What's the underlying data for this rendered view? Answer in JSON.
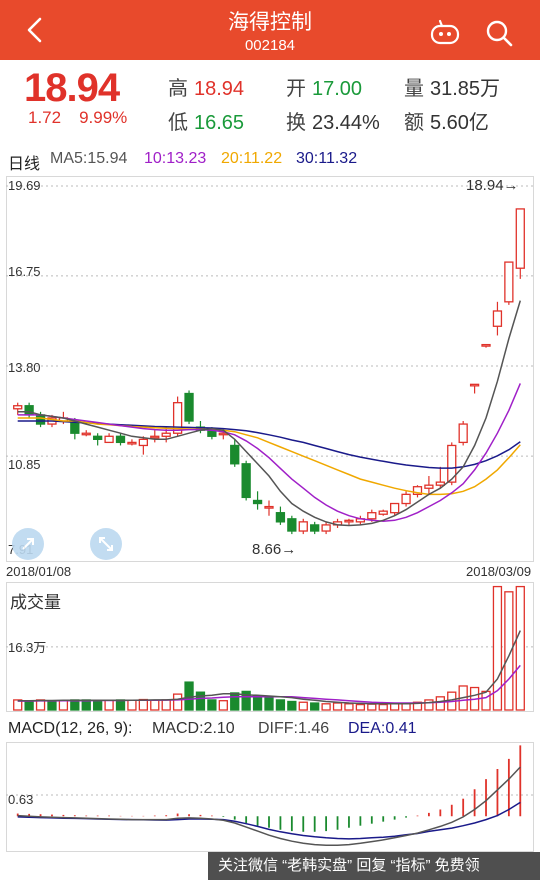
{
  "header": {
    "title": "海得控制",
    "code": "002184",
    "bg_color": "#e84a2c"
  },
  "quote": {
    "price": "18.94",
    "change": "1.72",
    "change_pct": "9.99%",
    "high_label": "高",
    "high": "18.94",
    "low_label": "低",
    "low": "16.65",
    "open_label": "开",
    "open": "17.00",
    "turnover_label": "换",
    "turnover": "23.44%",
    "volume_label": "量",
    "volume": "31.85万",
    "amount_label": "额",
    "amount": "5.60亿"
  },
  "ma_legend": {
    "label": "日线",
    "ma5": "MA5:15.94",
    "ma10": "10:13.23",
    "ma20": "20:11.22",
    "ma30": "30:11.32",
    "colors": {
      "ma5": "#555555",
      "ma10": "#a020c8",
      "ma20": "#f0a800",
      "ma30": "#1a1a8a"
    }
  },
  "macd_legend": {
    "label": "MACD(12, 26, 9):",
    "macd": "MACD:2.10",
    "diff": "DIFF:1.46",
    "dea": "DEA:0.41"
  },
  "footer": {
    "text": "关注微信 “老韩实盘” 回复 “指标” 免费领"
  },
  "chart_data": [
    {
      "type": "candlestick",
      "y_ticks": [
        "19.69",
        "16.75",
        "13.80",
        "10.85",
        "7.91"
      ],
      "ylim": [
        7.91,
        19.69
      ],
      "x_start_label": "2018/01/08",
      "x_end_label": "2018/03/09",
      "annotations": {
        "high": "18.94→",
        "low": "8.66→"
      },
      "candles": [
        [
          12.4,
          12.6,
          12.2,
          12.5
        ],
        [
          12.5,
          12.6,
          12.1,
          12.2
        ],
        [
          12.2,
          12.3,
          11.8,
          11.9
        ],
        [
          11.9,
          12.2,
          11.8,
          12.1
        ],
        [
          12.0,
          12.3,
          11.9,
          12.1
        ],
        [
          12.0,
          12.1,
          11.4,
          11.6
        ],
        [
          11.6,
          11.7,
          11.5,
          11.6
        ],
        [
          11.5,
          11.6,
          11.2,
          11.4
        ],
        [
          11.3,
          11.6,
          11.3,
          11.5
        ],
        [
          11.5,
          11.6,
          11.2,
          11.3
        ],
        [
          11.3,
          11.4,
          11.2,
          11.3
        ],
        [
          11.2,
          11.5,
          10.9,
          11.4
        ],
        [
          11.5,
          11.7,
          11.3,
          11.5
        ],
        [
          11.5,
          11.8,
          11.3,
          11.6
        ],
        [
          11.6,
          12.8,
          11.5,
          12.6
        ],
        [
          12.9,
          13.0,
          11.9,
          12.0
        ],
        [
          11.8,
          12.0,
          11.6,
          11.7
        ],
        [
          11.7,
          11.8,
          11.4,
          11.5
        ],
        [
          11.6,
          11.7,
          11.4,
          11.6
        ],
        [
          11.2,
          11.4,
          10.5,
          10.6
        ],
        [
          10.6,
          10.7,
          9.4,
          9.5
        ],
        [
          9.4,
          9.7,
          9.1,
          9.3
        ],
        [
          9.2,
          9.4,
          8.9,
          9.2
        ],
        [
          9.0,
          9.2,
          8.6,
          8.7
        ],
        [
          8.8,
          8.9,
          8.3,
          8.4
        ],
        [
          8.4,
          8.8,
          8.3,
          8.7
        ],
        [
          8.6,
          8.7,
          8.3,
          8.4
        ],
        [
          8.4,
          8.7,
          8.3,
          8.6
        ],
        [
          8.6,
          8.8,
          8.5,
          8.7
        ],
        [
          8.7,
          8.8,
          8.6,
          8.75
        ],
        [
          8.7,
          8.9,
          8.6,
          8.8
        ],
        [
          8.8,
          9.1,
          8.7,
          9.0
        ],
        [
          8.95,
          9.1,
          8.9,
          9.05
        ],
        [
          9.0,
          9.3,
          8.9,
          9.3
        ],
        [
          9.3,
          9.7,
          9.2,
          9.6
        ],
        [
          9.6,
          9.9,
          9.5,
          9.85
        ],
        [
          9.8,
          10.2,
          9.6,
          9.9
        ],
        [
          9.9,
          10.5,
          9.8,
          10.0
        ],
        [
          10.0,
          11.3,
          9.9,
          11.2
        ],
        [
          11.3,
          12.0,
          11.2,
          11.9
        ],
        [
          13.2,
          13.2,
          12.9,
          13.2
        ],
        [
          14.5,
          14.5,
          14.4,
          14.5
        ],
        [
          15.1,
          15.9,
          14.8,
          15.6
        ],
        [
          15.9,
          17.2,
          15.8,
          17.2
        ],
        [
          17.0,
          18.94,
          16.65,
          18.94
        ]
      ],
      "ma5": [
        12.3,
        12.3,
        12.2,
        12.15,
        12.1,
        12.0,
        11.9,
        11.8,
        11.7,
        11.6,
        11.5,
        11.45,
        11.4,
        11.4,
        11.5,
        11.6,
        11.7,
        11.75,
        11.7,
        11.4,
        11.0,
        10.6,
        10.2,
        9.7,
        9.3,
        9.05,
        8.85,
        8.7,
        8.6,
        8.58,
        8.6,
        8.65,
        8.75,
        8.9,
        9.1,
        9.35,
        9.6,
        9.8,
        10.1,
        10.5,
        11.2,
        12.1,
        13.3,
        14.7,
        15.94
      ],
      "ma10": [
        12.2,
        12.2,
        12.2,
        12.15,
        12.1,
        12.05,
        12.0,
        11.95,
        11.9,
        11.85,
        11.8,
        11.75,
        11.72,
        11.7,
        11.7,
        11.72,
        11.72,
        11.7,
        11.65,
        11.55,
        11.35,
        11.1,
        10.8,
        10.45,
        10.1,
        9.8,
        9.5,
        9.25,
        9.05,
        8.9,
        8.8,
        8.75,
        8.72,
        8.75,
        8.85,
        9.0,
        9.2,
        9.4,
        9.65,
        9.95,
        10.4,
        10.95,
        11.6,
        12.35,
        13.23
      ],
      "ma20": [
        12.1,
        12.1,
        12.1,
        12.05,
        12.0,
        12.0,
        11.95,
        11.9,
        11.88,
        11.85,
        11.82,
        11.8,
        11.78,
        11.76,
        11.75,
        11.74,
        11.73,
        11.72,
        11.7,
        11.65,
        11.55,
        11.45,
        11.3,
        11.15,
        11.0,
        10.85,
        10.7,
        10.55,
        10.4,
        10.25,
        10.1,
        10.0,
        9.9,
        9.8,
        9.72,
        9.65,
        9.6,
        9.6,
        9.62,
        9.7,
        9.85,
        10.1,
        10.4,
        10.8,
        11.22
      ],
      "ma30": [
        12.0,
        12.0,
        12.0,
        12.0,
        11.98,
        11.96,
        11.94,
        11.92,
        11.9,
        11.88,
        11.86,
        11.84,
        11.82,
        11.81,
        11.8,
        11.79,
        11.78,
        11.77,
        11.75,
        11.72,
        11.68,
        11.62,
        11.55,
        11.47,
        11.38,
        11.3,
        11.2,
        11.1,
        11.0,
        10.9,
        10.82,
        10.75,
        10.68,
        10.62,
        10.56,
        10.52,
        10.48,
        10.46,
        10.46,
        10.5,
        10.58,
        10.7,
        10.86,
        11.06,
        11.32
      ]
    },
    {
      "type": "bar",
      "title": "成交量",
      "y_tick": "16.3万",
      "unit": "万",
      "values": [
        2.6,
        2.4,
        2.6,
        2.2,
        2.4,
        2.6,
        2.6,
        2.5,
        2.5,
        2.6,
        2.5,
        2.7,
        2.5,
        2.6,
        4.1,
        7.2,
        4.6,
        2.6,
        2.4,
        4.4,
        4.8,
        3.6,
        3.2,
        2.6,
        2.2,
        2.0,
        1.8,
        1.6,
        1.8,
        1.6,
        1.4,
        1.5,
        1.4,
        1.6,
        1.6,
        2.0,
        2.6,
        3.4,
        4.6,
        6.2,
        5.8,
        4.8,
        31.85,
        30.5,
        31.85
      ],
      "ma5": [
        2.4,
        2.4,
        2.45,
        2.45,
        2.5,
        2.5,
        2.5,
        2.5,
        2.5,
        2.5,
        2.5,
        2.55,
        2.6,
        2.6,
        2.8,
        3.3,
        3.6,
        3.8,
        4.2,
        4.2,
        3.9,
        3.8,
        3.6,
        3.4,
        3.2,
        2.8,
        2.5,
        2.2,
        2.0,
        1.8,
        1.7,
        1.6,
        1.6,
        1.6,
        1.6,
        1.7,
        1.9,
        2.2,
        2.6,
        3.2,
        3.8,
        4.6,
        8.0,
        14.0,
        20.5
      ],
      "ma10": [
        2.3,
        2.3,
        2.35,
        2.35,
        2.4,
        2.4,
        2.4,
        2.45,
        2.45,
        2.45,
        2.5,
        2.5,
        2.5,
        2.55,
        2.6,
        2.8,
        3.0,
        3.1,
        3.3,
        3.4,
        3.4,
        3.4,
        3.4,
        3.4,
        3.4,
        3.2,
        3.0,
        2.8,
        2.6,
        2.4,
        2.2,
        2.0,
        1.9,
        1.8,
        1.8,
        1.8,
        1.85,
        2.0,
        2.2,
        2.5,
        2.8,
        3.2,
        5.0,
        8.0,
        11.5
      ],
      "colors": [
        "r",
        "g",
        "r",
        "g",
        "r",
        "g",
        "g",
        "g",
        "r",
        "g",
        "r",
        "r",
        "r",
        "r",
        "r",
        "g",
        "g",
        "g",
        "r",
        "g",
        "g",
        "g",
        "g",
        "g",
        "g",
        "r",
        "g",
        "r",
        "r",
        "r",
        "r",
        "r",
        "r",
        "r",
        "r",
        "r",
        "r",
        "r",
        "r",
        "r",
        "r",
        "r",
        "r",
        "r",
        "r"
      ]
    },
    {
      "type": "bar",
      "title": "MACD(12, 26, 9)",
      "y_tick": "0.63",
      "macd": [
        0.08,
        0.07,
        0.06,
        0.05,
        0.04,
        0.03,
        0.02,
        0.02,
        0.02,
        0.01,
        0.01,
        0.01,
        0.02,
        0.03,
        0.08,
        0.06,
        0.04,
        0.02,
        -0.02,
        -0.1,
        -0.2,
        -0.28,
        -0.34,
        -0.4,
        -0.44,
        -0.46,
        -0.46,
        -0.44,
        -0.4,
        -0.34,
        -0.28,
        -0.22,
        -0.16,
        -0.1,
        -0.04,
        0.02,
        0.1,
        0.2,
        0.34,
        0.52,
        0.8,
        1.1,
        1.4,
        1.7,
        2.1
      ],
      "diff": [
        0.02,
        0.0,
        -0.02,
        -0.03,
        -0.04,
        -0.05,
        -0.06,
        -0.07,
        -0.08,
        -0.09,
        -0.1,
        -0.1,
        -0.1,
        -0.1,
        -0.06,
        -0.05,
        -0.06,
        -0.08,
        -0.12,
        -0.2,
        -0.32,
        -0.44,
        -0.56,
        -0.66,
        -0.74,
        -0.8,
        -0.84,
        -0.86,
        -0.86,
        -0.84,
        -0.8,
        -0.75,
        -0.7,
        -0.64,
        -0.57,
        -0.5,
        -0.4,
        -0.3,
        -0.18,
        -0.02,
        0.2,
        0.46,
        0.78,
        1.1,
        1.46
      ],
      "dea": [
        -0.02,
        -0.03,
        -0.04,
        -0.05,
        -0.06,
        -0.065,
        -0.07,
        -0.08,
        -0.09,
        -0.095,
        -0.1,
        -0.105,
        -0.11,
        -0.115,
        -0.1,
        -0.08,
        -0.08,
        -0.09,
        -0.1,
        -0.15,
        -0.22,
        -0.3,
        -0.39,
        -0.46,
        -0.52,
        -0.57,
        -0.61,
        -0.64,
        -0.66,
        -0.67,
        -0.66,
        -0.64,
        -0.62,
        -0.59,
        -0.55,
        -0.51,
        -0.45,
        -0.4,
        -0.35,
        -0.28,
        -0.2,
        -0.1,
        0.02,
        0.2,
        0.41
      ],
      "ylim": [
        -1.0,
        2.2
      ]
    }
  ]
}
